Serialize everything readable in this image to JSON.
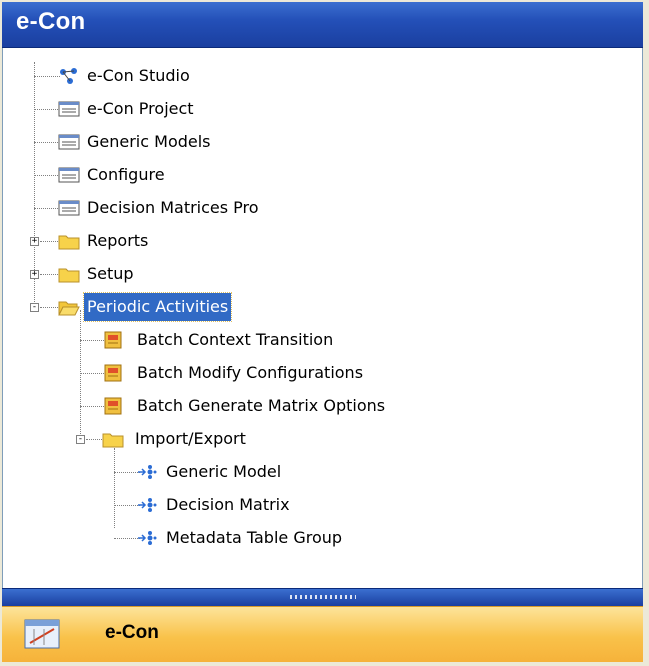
{
  "header": {
    "title": "e-Con"
  },
  "tree": [
    {
      "label": "e-Con Studio",
      "icon": "network-icon"
    },
    {
      "label": "e-Con Project",
      "icon": "form-icon"
    },
    {
      "label": "Generic Models",
      "icon": "form-icon"
    },
    {
      "label": "Configure",
      "icon": "form-icon"
    },
    {
      "label": "Decision Matrices Pro",
      "icon": "form-icon"
    },
    {
      "label": "Reports",
      "icon": "folder-icon",
      "expander": "+"
    },
    {
      "label": "Setup",
      "icon": "folder-icon",
      "expander": "+"
    },
    {
      "label": "Periodic Activities",
      "icon": "folder-open-icon",
      "expander": "-",
      "selected": true
    },
    {
      "label": "Batch Context Transition",
      "icon": "report-icon"
    },
    {
      "label": "Batch Modify Configurations",
      "icon": "report-icon"
    },
    {
      "label": "Batch Generate Matrix Options",
      "icon": "report-icon"
    },
    {
      "label": "Import/Export",
      "icon": "folder-icon",
      "expander": "-"
    },
    {
      "label": "Generic Model",
      "icon": "action-icon"
    },
    {
      "label": "Decision Matrix",
      "icon": "action-icon"
    },
    {
      "label": "Metadata Table Group",
      "icon": "action-icon"
    }
  ],
  "footer": {
    "title": "e-Con",
    "icon": "econ-module-icon"
  },
  "colors": {
    "header": "#2450b8",
    "selection": "#316ac5",
    "footer": "#f9c24a"
  }
}
